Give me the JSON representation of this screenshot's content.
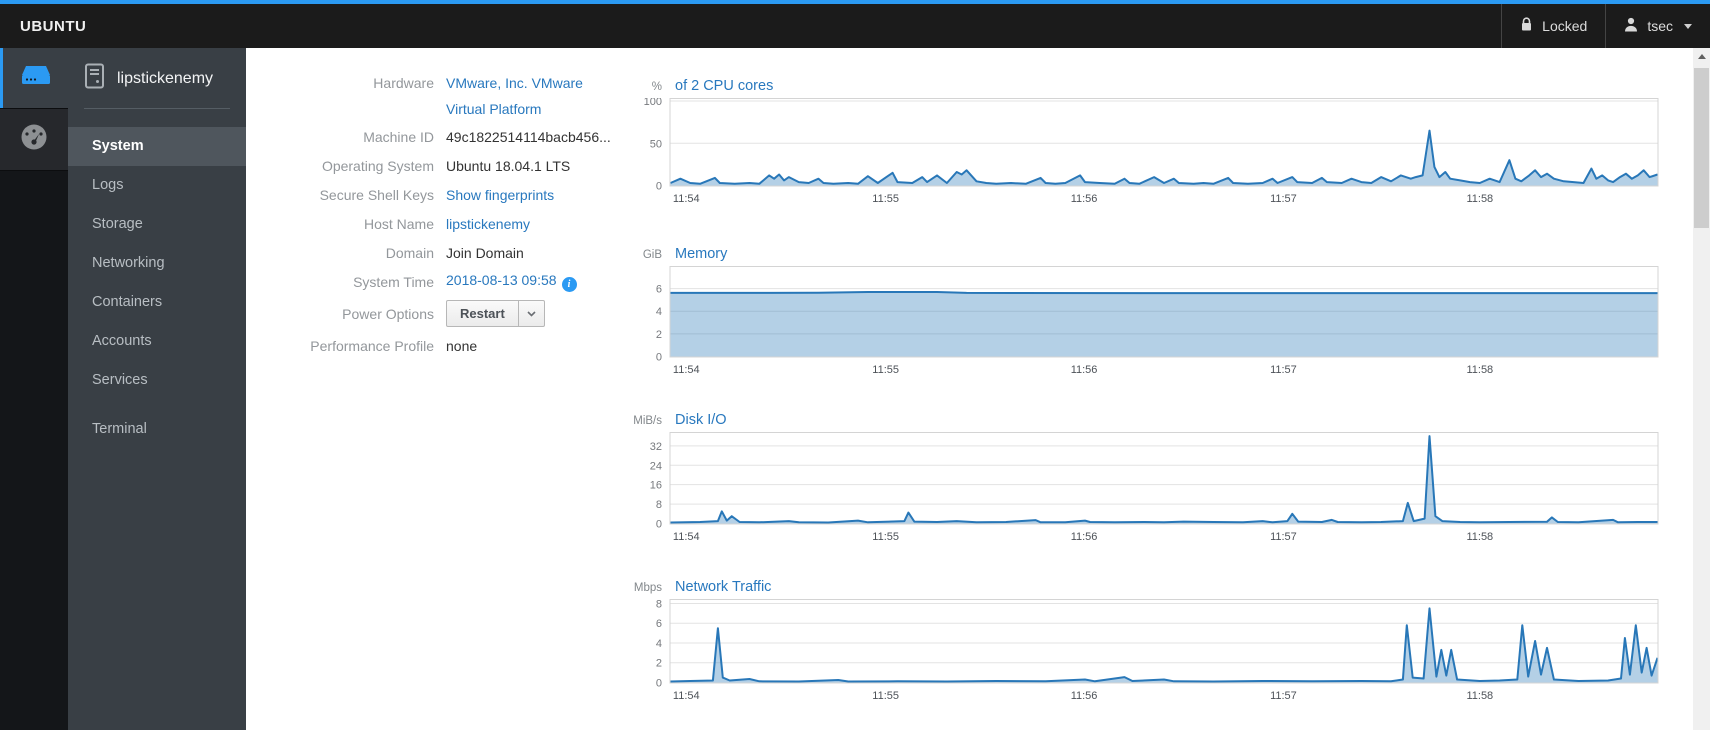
{
  "masthead": {
    "brand": "UBUNTU",
    "locked_label": "Locked",
    "user": "tsec"
  },
  "sidebar": {
    "hostname": "lipstickenemy",
    "items": [
      {
        "label": "System"
      },
      {
        "label": "Logs"
      },
      {
        "label": "Storage"
      },
      {
        "label": "Networking"
      },
      {
        "label": "Containers"
      },
      {
        "label": "Accounts"
      },
      {
        "label": "Services"
      },
      {
        "label": "Terminal"
      }
    ]
  },
  "info": {
    "hardware_label": "Hardware",
    "hardware_line1": "VMware, Inc. VMware",
    "hardware_line2": "Virtual Platform",
    "machine_id_label": "Machine ID",
    "machine_id": "49c1822514114bacb456...",
    "os_label": "Operating System",
    "os": "Ubuntu 18.04.1 LTS",
    "ssh_label": "Secure Shell Keys",
    "ssh_link": "Show fingerprints",
    "hostname_label": "Host Name",
    "hostname_link": "lipstickenemy",
    "domain_label": "Domain",
    "domain_value": "Join Domain",
    "time_label": "System Time",
    "time_link": "2018-08-13 09:58",
    "power_label": "Power Options",
    "power_button": "Restart",
    "profile_label": "Performance Profile",
    "profile_value": "none"
  },
  "colors": {
    "accent_blue": "#2b9af3",
    "link_blue": "#2878be",
    "chart_line": "#2877b8",
    "chart_fill_opacity": 0.35,
    "chart_frame": "#d4d4d4",
    "chart_grid": "#e3e3e3",
    "ytick_text": "#76797d",
    "xtick_text": "#4d5258"
  },
  "chart_data": [
    {
      "type": "area",
      "unit": "%",
      "title": "of 2 CPU cores",
      "height": 88,
      "ylim": [
        0,
        103
      ],
      "yticks": [
        100,
        50,
        0
      ],
      "xtick_labels": [
        "11:54",
        "11:55",
        "11:56",
        "11:57",
        "11:58"
      ],
      "xtick_fractions": [
        0.016,
        0.218,
        0.419,
        0.621,
        0.82
      ],
      "points": [
        [
          0,
          3
        ],
        [
          0.01,
          8
        ],
        [
          0.02,
          3
        ],
        [
          0.03,
          2
        ],
        [
          0.045,
          9
        ],
        [
          0.05,
          3
        ],
        [
          0.065,
          2
        ],
        [
          0.08,
          3
        ],
        [
          0.09,
          2
        ],
        [
          0.1,
          12
        ],
        [
          0.105,
          8
        ],
        [
          0.11,
          13
        ],
        [
          0.115,
          6
        ],
        [
          0.12,
          10
        ],
        [
          0.13,
          4
        ],
        [
          0.14,
          3
        ],
        [
          0.15,
          8
        ],
        [
          0.155,
          3
        ],
        [
          0.165,
          2
        ],
        [
          0.18,
          3
        ],
        [
          0.19,
          2
        ],
        [
          0.2,
          11
        ],
        [
          0.21,
          3
        ],
        [
          0.225,
          15
        ],
        [
          0.23,
          4
        ],
        [
          0.245,
          3
        ],
        [
          0.255,
          10
        ],
        [
          0.26,
          4
        ],
        [
          0.27,
          12
        ],
        [
          0.28,
          3
        ],
        [
          0.29,
          16
        ],
        [
          0.295,
          13
        ],
        [
          0.3,
          18
        ],
        [
          0.31,
          5
        ],
        [
          0.32,
          3
        ],
        [
          0.33,
          2
        ],
        [
          0.345,
          3
        ],
        [
          0.36,
          2
        ],
        [
          0.375,
          9
        ],
        [
          0.38,
          3
        ],
        [
          0.39,
          2
        ],
        [
          0.4,
          3
        ],
        [
          0.415,
          12
        ],
        [
          0.42,
          4
        ],
        [
          0.435,
          3
        ],
        [
          0.45,
          2
        ],
        [
          0.46,
          8
        ],
        [
          0.465,
          3
        ],
        [
          0.475,
          2
        ],
        [
          0.49,
          10
        ],
        [
          0.5,
          3
        ],
        [
          0.51,
          8
        ],
        [
          0.515,
          3
        ],
        [
          0.53,
          2
        ],
        [
          0.54,
          3
        ],
        [
          0.55,
          2
        ],
        [
          0.565,
          9
        ],
        [
          0.57,
          3
        ],
        [
          0.585,
          2
        ],
        [
          0.6,
          3
        ],
        [
          0.61,
          8
        ],
        [
          0.615,
          3
        ],
        [
          0.63,
          10
        ],
        [
          0.635,
          4
        ],
        [
          0.65,
          3
        ],
        [
          0.66,
          9
        ],
        [
          0.665,
          4
        ],
        [
          0.68,
          3
        ],
        [
          0.69,
          8
        ],
        [
          0.7,
          4
        ],
        [
          0.71,
          3
        ],
        [
          0.72,
          10
        ],
        [
          0.73,
          5
        ],
        [
          0.74,
          12
        ],
        [
          0.75,
          8
        ],
        [
          0.755,
          10
        ],
        [
          0.762,
          12
        ],
        [
          0.769,
          65
        ],
        [
          0.774,
          22
        ],
        [
          0.779,
          10
        ],
        [
          0.785,
          16
        ],
        [
          0.79,
          8
        ],
        [
          0.8,
          6
        ],
        [
          0.81,
          4
        ],
        [
          0.82,
          3
        ],
        [
          0.83,
          8
        ],
        [
          0.84,
          4
        ],
        [
          0.85,
          30
        ],
        [
          0.856,
          8
        ],
        [
          0.862,
          5
        ],
        [
          0.87,
          12
        ],
        [
          0.876,
          18
        ],
        [
          0.882,
          10
        ],
        [
          0.888,
          14
        ],
        [
          0.895,
          8
        ],
        [
          0.905,
          5
        ],
        [
          0.915,
          4
        ],
        [
          0.925,
          3
        ],
        [
          0.933,
          20
        ],
        [
          0.938,
          8
        ],
        [
          0.944,
          12
        ],
        [
          0.95,
          6
        ],
        [
          0.955,
          4
        ],
        [
          0.962,
          10
        ],
        [
          0.968,
          14
        ],
        [
          0.974,
          8
        ],
        [
          0.98,
          12
        ],
        [
          0.986,
          18
        ],
        [
          0.992,
          10
        ],
        [
          1,
          13
        ]
      ]
    },
    {
      "type": "area",
      "unit": "GiB",
      "title": "Memory",
      "height": 91,
      "ylim": [
        0,
        7.95
      ],
      "yticks": [
        6,
        4,
        2,
        0
      ],
      "xtick_labels": [
        "11:54",
        "11:55",
        "11:56",
        "11:57",
        "11:58"
      ],
      "xtick_fractions": [
        0.016,
        0.218,
        0.419,
        0.621,
        0.82
      ],
      "points": [
        [
          0,
          5.62
        ],
        [
          0.1,
          5.62
        ],
        [
          0.15,
          5.63
        ],
        [
          0.2,
          5.7
        ],
        [
          0.27,
          5.7
        ],
        [
          0.3,
          5.62
        ],
        [
          0.5,
          5.6
        ],
        [
          0.75,
          5.6
        ],
        [
          1,
          5.6
        ]
      ]
    },
    {
      "type": "area",
      "unit": "MiB/s",
      "title": "Disk I/O",
      "height": 92,
      "ylim": [
        0,
        37.5
      ],
      "yticks": [
        32,
        24,
        16,
        8,
        0
      ],
      "xtick_labels": [
        "11:54",
        "11:55",
        "11:56",
        "11:57",
        "11:58"
      ],
      "xtick_fractions": [
        0.016,
        0.218,
        0.419,
        0.621,
        0.82
      ],
      "points": [
        [
          0,
          0.4
        ],
        [
          0.03,
          0.6
        ],
        [
          0.048,
          1
        ],
        [
          0.052,
          5
        ],
        [
          0.057,
          1.2
        ],
        [
          0.062,
          3
        ],
        [
          0.07,
          0.6
        ],
        [
          0.09,
          0.5
        ],
        [
          0.12,
          1
        ],
        [
          0.13,
          0.5
        ],
        [
          0.16,
          0.4
        ],
        [
          0.19,
          1.2
        ],
        [
          0.2,
          0.5
        ],
        [
          0.237,
          1
        ],
        [
          0.241,
          4.5
        ],
        [
          0.247,
          0.8
        ],
        [
          0.27,
          0.6
        ],
        [
          0.29,
          1
        ],
        [
          0.31,
          0.5
        ],
        [
          0.34,
          0.6
        ],
        [
          0.37,
          1.4
        ],
        [
          0.375,
          0.5
        ],
        [
          0.4,
          0.5
        ],
        [
          0.42,
          1.2
        ],
        [
          0.425,
          0.6
        ],
        [
          0.45,
          0.5
        ],
        [
          0.48,
          0.6
        ],
        [
          0.5,
          0.5
        ],
        [
          0.52,
          0.8
        ],
        [
          0.55,
          0.6
        ],
        [
          0.58,
          0.5
        ],
        [
          0.6,
          1
        ],
        [
          0.61,
          0.5
        ],
        [
          0.625,
          1
        ],
        [
          0.63,
          4
        ],
        [
          0.636,
          0.8
        ],
        [
          0.66,
          0.6
        ],
        [
          0.67,
          1.5
        ],
        [
          0.676,
          0.6
        ],
        [
          0.7,
          0.5
        ],
        [
          0.72,
          0.6
        ],
        [
          0.742,
          1
        ],
        [
          0.747,
          8.5
        ],
        [
          0.753,
          1
        ],
        [
          0.764,
          2
        ],
        [
          0.769,
          36
        ],
        [
          0.775,
          3
        ],
        [
          0.782,
          1
        ],
        [
          0.8,
          0.6
        ],
        [
          0.82,
          0.5
        ],
        [
          0.85,
          0.6
        ],
        [
          0.888,
          0.7
        ],
        [
          0.893,
          2.5
        ],
        [
          0.899,
          0.6
        ],
        [
          0.92,
          0.5
        ],
        [
          0.955,
          1.5
        ],
        [
          0.96,
          0.5
        ],
        [
          0.98,
          0.6
        ],
        [
          1,
          0.6
        ]
      ]
    },
    {
      "type": "area",
      "unit": "Mbps",
      "title": "Network Traffic",
      "height": 84,
      "ylim": [
        0,
        8.4
      ],
      "yticks": [
        8,
        6,
        4,
        2,
        0
      ],
      "xtick_labels": [
        "11:54",
        "11:55",
        "11:56",
        "11:57",
        "11:58"
      ],
      "xtick_fractions": [
        0.016,
        0.218,
        0.419,
        0.621,
        0.82
      ],
      "points": [
        [
          0,
          0.1
        ],
        [
          0.02,
          0.15
        ],
        [
          0.043,
          0.2
        ],
        [
          0.048,
          5.5
        ],
        [
          0.053,
          0.5
        ],
        [
          0.06,
          0.2
        ],
        [
          0.08,
          0.35
        ],
        [
          0.09,
          0.12
        ],
        [
          0.13,
          0.1
        ],
        [
          0.17,
          0.25
        ],
        [
          0.18,
          0.1
        ],
        [
          0.23,
          0.12
        ],
        [
          0.28,
          0.1
        ],
        [
          0.33,
          0.15
        ],
        [
          0.38,
          0.12
        ],
        [
          0.42,
          0.3
        ],
        [
          0.43,
          0.12
        ],
        [
          0.46,
          0.55
        ],
        [
          0.468,
          0.15
        ],
        [
          0.5,
          0.3
        ],
        [
          0.51,
          0.12
        ],
        [
          0.55,
          0.1
        ],
        [
          0.6,
          0.15
        ],
        [
          0.65,
          0.12
        ],
        [
          0.7,
          0.15
        ],
        [
          0.73,
          0.12
        ],
        [
          0.742,
          0.3
        ],
        [
          0.746,
          5.8
        ],
        [
          0.752,
          0.5
        ],
        [
          0.763,
          0.4
        ],
        [
          0.769,
          7.5
        ],
        [
          0.776,
          0.6
        ],
        [
          0.781,
          3.3
        ],
        [
          0.786,
          0.7
        ],
        [
          0.791,
          3.3
        ],
        [
          0.797,
          0.3
        ],
        [
          0.82,
          0.15
        ],
        [
          0.84,
          0.2
        ],
        [
          0.858,
          0.3
        ],
        [
          0.863,
          5.8
        ],
        [
          0.869,
          0.6
        ],
        [
          0.876,
          4.2
        ],
        [
          0.882,
          0.8
        ],
        [
          0.888,
          3.5
        ],
        [
          0.895,
          0.3
        ],
        [
          0.92,
          0.15
        ],
        [
          0.95,
          0.2
        ],
        [
          0.963,
          0.4
        ],
        [
          0.967,
          4.5
        ],
        [
          0.972,
          0.8
        ],
        [
          0.978,
          5.8
        ],
        [
          0.984,
          1.0
        ],
        [
          0.989,
          3.5
        ],
        [
          0.994,
          0.7
        ],
        [
          1,
          2.5
        ]
      ]
    }
  ]
}
